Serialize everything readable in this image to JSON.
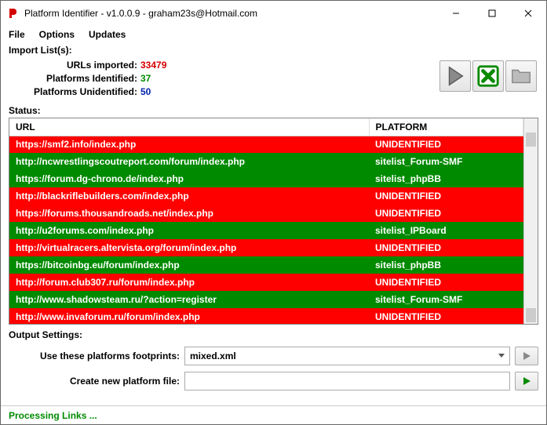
{
  "window": {
    "title": "Platform Identifier - v1.0.0.9 - graham23s@Hotmail.com"
  },
  "menu": {
    "file": "File",
    "options": "Options",
    "updates": "Updates"
  },
  "import": {
    "heading": "Import List(s):",
    "urls_label": "URLs imported:",
    "urls_value": "33479",
    "ident_label": "Platforms Identified:",
    "ident_value": "37",
    "unident_label": "Platforms Unidentified:",
    "unident_value": "50"
  },
  "status": {
    "heading": "Status:",
    "col_url": "URL",
    "col_platform": "PLATFORM",
    "rows": [
      {
        "url": "https://smf2.info/index.php",
        "platform": "UNIDENTIFIED",
        "state": "red"
      },
      {
        "url": "http://ncwrestlingscoutreport.com/forum/index.php",
        "platform": "sitelist_Forum-SMF",
        "state": "green"
      },
      {
        "url": "https://forum.dg-chrono.de/index.php",
        "platform": "sitelist_phpBB",
        "state": "green"
      },
      {
        "url": "http://blackriflebuilders.com/index.php",
        "platform": "UNIDENTIFIED",
        "state": "red"
      },
      {
        "url": "https://forums.thousandroads.net/index.php",
        "platform": "UNIDENTIFIED",
        "state": "red"
      },
      {
        "url": "http://u2forums.com/index.php",
        "platform": "sitelist_IPBoard",
        "state": "green"
      },
      {
        "url": "http://virtualracers.altervista.org/forum/index.php",
        "platform": "UNIDENTIFIED",
        "state": "red"
      },
      {
        "url": "https://bitcoinbg.eu/forum/index.php",
        "platform": "sitelist_phpBB",
        "state": "green"
      },
      {
        "url": "http://forum.club307.ru/forum/index.php",
        "platform": "UNIDENTIFIED",
        "state": "red"
      },
      {
        "url": "http://www.shadowsteam.ru/?action=register",
        "platform": "sitelist_Forum-SMF",
        "state": "green"
      },
      {
        "url": "http://www.invaforum.ru/forum/index.php",
        "platform": "UNIDENTIFIED",
        "state": "red"
      }
    ]
  },
  "output": {
    "heading": "Output Settings:",
    "footprints_label": "Use these platforms footprints:",
    "footprints_value": "mixed.xml",
    "create_label": "Create new platform file:",
    "create_value": ""
  },
  "statusbar": {
    "text": "Processing Links ..."
  }
}
